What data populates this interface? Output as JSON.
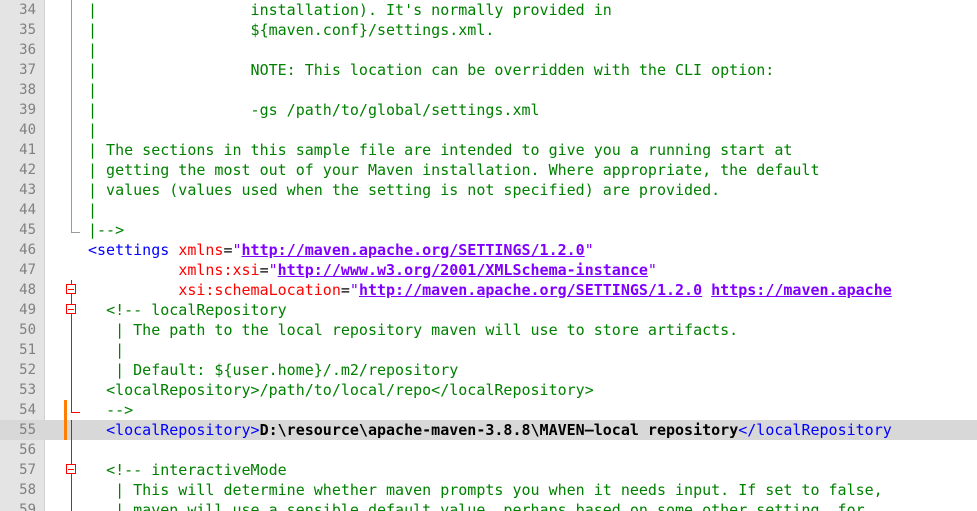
{
  "editor": {
    "lines": [
      {
        "num": "34",
        "segments": [
          {
            "t": "comment",
            "v": "|                 installation). It's normally provided in"
          }
        ],
        "gutter": "vgray"
      },
      {
        "num": "35",
        "segments": [
          {
            "t": "comment",
            "v": "|                 ${maven.conf}/settings.xml."
          }
        ],
        "gutter": "vgray"
      },
      {
        "num": "36",
        "segments": [
          {
            "t": "comment",
            "v": "|"
          }
        ],
        "gutter": "vgray"
      },
      {
        "num": "37",
        "segments": [
          {
            "t": "comment",
            "v": "|                 NOTE: This location can be overridden with the CLI option:"
          }
        ],
        "gutter": "vgray"
      },
      {
        "num": "38",
        "segments": [
          {
            "t": "comment",
            "v": "|"
          }
        ],
        "gutter": "vgray"
      },
      {
        "num": "39",
        "segments": [
          {
            "t": "comment",
            "v": "|                 -gs /path/to/global/settings.xml"
          }
        ],
        "gutter": "vgray"
      },
      {
        "num": "40",
        "segments": [
          {
            "t": "comment",
            "v": "|"
          }
        ],
        "gutter": "vgray"
      },
      {
        "num": "41",
        "segments": [
          {
            "t": "comment",
            "v": "| The sections in this sample file are intended to give you a running start at"
          }
        ],
        "gutter": "vgray"
      },
      {
        "num": "42",
        "segments": [
          {
            "t": "comment",
            "v": "| getting the most out of your Maven installation. Where appropriate, the default"
          }
        ],
        "gutter": "vgray"
      },
      {
        "num": "43",
        "segments": [
          {
            "t": "comment",
            "v": "| values (values used when the setting is not specified) are provided."
          }
        ],
        "gutter": "vgray"
      },
      {
        "num": "44",
        "segments": [
          {
            "t": "comment",
            "v": "|"
          }
        ],
        "gutter": "vgray"
      },
      {
        "num": "45",
        "segments": [
          {
            "t": "comment",
            "v": "|-->"
          }
        ],
        "gutter": "endgray"
      },
      {
        "num": "46",
        "segments": [
          {
            "t": "tag",
            "v": "<settings "
          },
          {
            "t": "attr",
            "v": "xmlns"
          },
          {
            "t": "plain",
            "v": "="
          },
          {
            "t": "str",
            "v": "\""
          },
          {
            "t": "url",
            "v": "http://maven.apache.org/SETTINGS/1.2.0"
          },
          {
            "t": "str",
            "v": "\""
          }
        ],
        "gutter": "none",
        "indent": "none"
      },
      {
        "num": "47",
        "segments": [
          {
            "t": "plain",
            "v": "          "
          },
          {
            "t": "attr",
            "v": "xmlns:xsi"
          },
          {
            "t": "plain",
            "v": "="
          },
          {
            "t": "str",
            "v": "\""
          },
          {
            "t": "url",
            "v": "http://www.w3.org/2001/XMLSchema-instance"
          },
          {
            "t": "str",
            "v": "\""
          }
        ],
        "gutter": "none",
        "indent": "none"
      },
      {
        "num": "48",
        "segments": [
          {
            "t": "plain",
            "v": "          "
          },
          {
            "t": "attr",
            "v": "xsi:schemaLocation"
          },
          {
            "t": "plain",
            "v": "="
          },
          {
            "t": "str",
            "v": "\""
          },
          {
            "t": "url",
            "v": "http://maven.apache.org/SETTINGS/1.2.0"
          },
          {
            "t": "plain",
            "v": " "
          },
          {
            "t": "url",
            "v": "https://maven.apache"
          }
        ],
        "gutter": "foldbox",
        "indent": "none"
      },
      {
        "num": "49",
        "segments": [
          {
            "t": "plain",
            "v": "  "
          },
          {
            "t": "comment",
            "v": "<!-- localRepository"
          }
        ],
        "gutter": "foldbox",
        "indent": "none"
      },
      {
        "num": "50",
        "segments": [
          {
            "t": "plain",
            "v": "   "
          },
          {
            "t": "comment",
            "v": "| The path to the local repository maven will use to store artifacts."
          }
        ],
        "gutter": "vred",
        "indent": "none"
      },
      {
        "num": "51",
        "segments": [
          {
            "t": "plain",
            "v": "   "
          },
          {
            "t": "comment",
            "v": "|"
          }
        ],
        "gutter": "vred",
        "indent": "none"
      },
      {
        "num": "52",
        "segments": [
          {
            "t": "plain",
            "v": "   "
          },
          {
            "t": "comment",
            "v": "| Default: ${user.home}/.m2/repository"
          }
        ],
        "gutter": "vred",
        "indent": "none"
      },
      {
        "num": "53",
        "segments": [
          {
            "t": "plain",
            "v": "  "
          },
          {
            "t": "comment",
            "v": "<localRepository>/path/to/local/repo</localRepository>"
          }
        ],
        "gutter": "vred",
        "indent": "none"
      },
      {
        "num": "54",
        "segments": [
          {
            "t": "plain",
            "v": "  "
          },
          {
            "t": "comment",
            "v": "-->"
          }
        ],
        "gutter": "endred",
        "change": true,
        "indent": "none"
      },
      {
        "num": "55",
        "segments": [
          {
            "t": "plain",
            "v": "  "
          },
          {
            "t": "tag",
            "v": "<localRepository>"
          },
          {
            "t": "bold",
            "v": "D:\\resource\\apache-maven-3.8.8\\MAVEN—local repository"
          },
          {
            "t": "tag",
            "v": "</localRepository"
          }
        ],
        "gutter": "vred",
        "change": true,
        "current": true,
        "indent": "none"
      },
      {
        "num": "56",
        "segments": [
          {
            "t": "plain",
            "v": ""
          }
        ],
        "gutter": "vred",
        "indent": "none"
      },
      {
        "num": "57",
        "segments": [
          {
            "t": "plain",
            "v": "  "
          },
          {
            "t": "comment",
            "v": "<!-- interactiveMode"
          }
        ],
        "gutter": "foldbox",
        "indent": "none"
      },
      {
        "num": "58",
        "segments": [
          {
            "t": "plain",
            "v": "   "
          },
          {
            "t": "comment",
            "v": "| This will determine whether maven prompts you when it needs input. If set to false,"
          }
        ],
        "gutter": "vred",
        "indent": "none"
      },
      {
        "num": "59",
        "segments": [
          {
            "t": "plain",
            "v": "   "
          },
          {
            "t": "comment",
            "v": "| maven will use a sensible default value, perhaps based on some other setting, for"
          }
        ],
        "gutter": "vred",
        "indent": "none"
      }
    ]
  }
}
